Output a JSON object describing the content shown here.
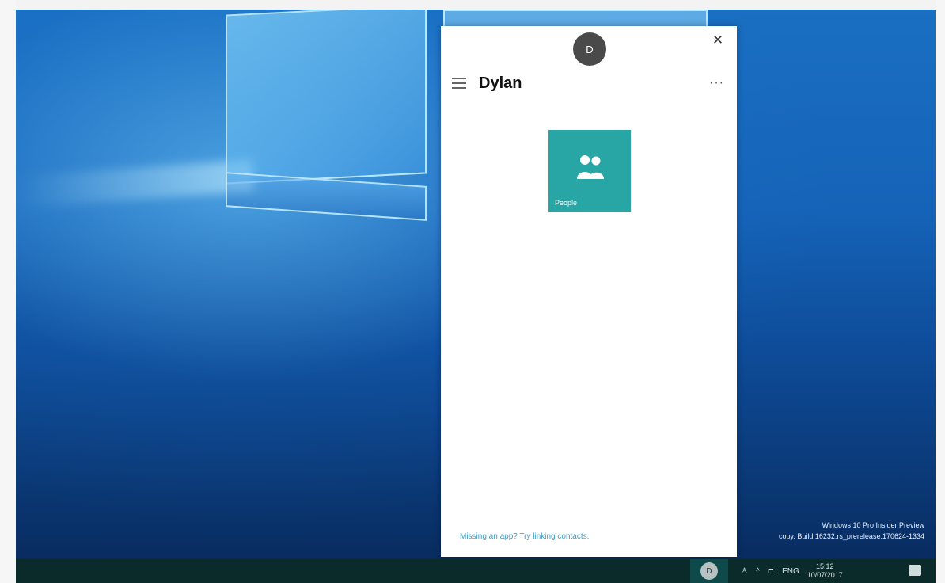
{
  "people_panel": {
    "avatar_initial": "D",
    "close_label": "✕",
    "contact_name": "Dylan",
    "more_label": "···",
    "app_tile": {
      "label": "People",
      "color": "#28a6a6"
    },
    "missing_app_link": "Missing an app? Try linking contacts."
  },
  "desktop": {
    "watermark_line1": "Windows 10 Pro Insider Preview",
    "watermark_line2": "copy. Build 16232.rs_prerelease.170624-1334"
  },
  "taskbar": {
    "people_button_initial": "D",
    "language": "ENG",
    "time": "15:12",
    "date": "10/07/2017"
  }
}
